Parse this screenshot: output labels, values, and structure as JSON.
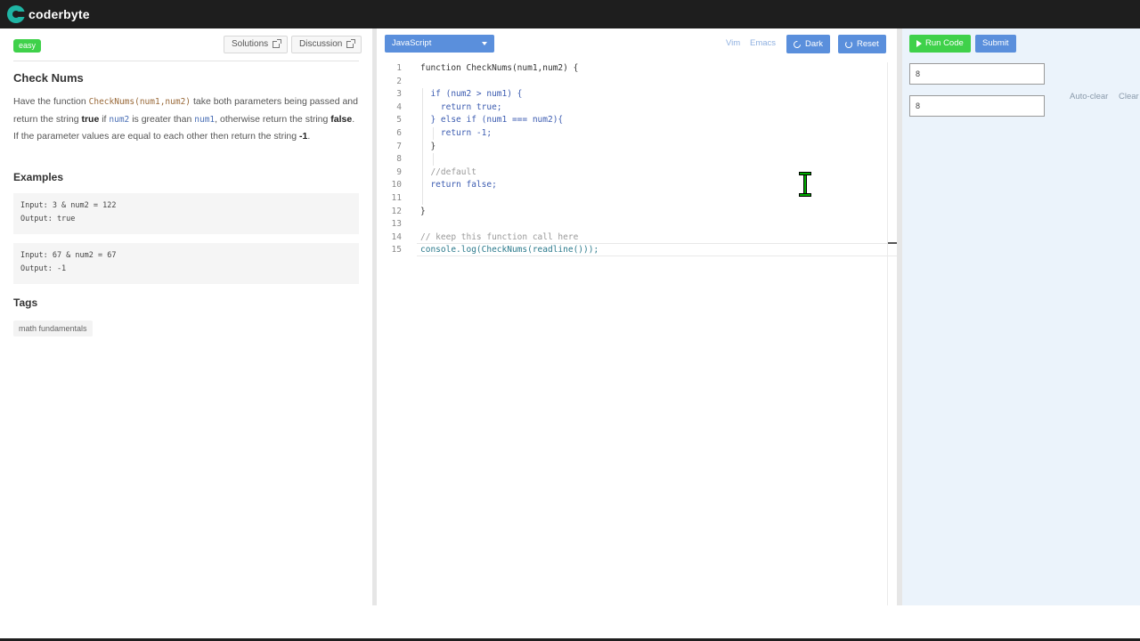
{
  "app": {
    "name": "coderbyte"
  },
  "problem": {
    "difficulty": "easy",
    "solutions_label": "Solutions",
    "discussion_label": "Discussion",
    "title": "Check Nums",
    "desc": {
      "p1": "Have the function ",
      "fn_sig": "CheckNums(num1,num2)",
      "p2": " take both parameters being passed and return the string ",
      "true_word": "true",
      "p3": " if ",
      "num2": "num2",
      "p4": " is greater than ",
      "num1": "num1",
      "p5": ", otherwise return the string ",
      "false_word": "false",
      "p6": ". If the parameter values are equal to each other then return the string ",
      "neg_one": "-1",
      "p7": "."
    },
    "examples_heading": "Examples",
    "examples": [
      {
        "input": "Input: 3 & num2 = 122",
        "output": "Output: true"
      },
      {
        "input": "Input: 67 & num2 = 67",
        "output": "Output: -1"
      }
    ],
    "tags_heading": "Tags",
    "tags": [
      "math fundamentals"
    ]
  },
  "editor": {
    "language": "JavaScript",
    "vim_label": "Vim",
    "emacs_label": "Emacs",
    "dark_label": "Dark",
    "reset_label": "Reset",
    "line_numbers": [
      "1",
      "2",
      "3",
      "4",
      "5",
      "6",
      "7",
      "8",
      "9",
      "10",
      "11",
      "12",
      "13",
      "14",
      "15"
    ],
    "lines": [
      "function CheckNums(num1,num2) {",
      "",
      "  if (num2 > num1) {",
      "    return true;",
      "  } else if (num1 === num2){",
      "    return -1;",
      "  }",
      "",
      "  //default",
      "  return false;",
      "",
      "}",
      "",
      "// keep this function call here",
      "console.log(CheckNums(readline()));"
    ]
  },
  "output": {
    "run_label": "Run Code",
    "submit_label": "Submit",
    "input_values": [
      "8",
      "8"
    ],
    "auto_clear_label": "Auto-clear",
    "clear_label": "Clear"
  },
  "colors": {
    "accent_blue": "#5a8fdc",
    "accent_green": "#3fd14a",
    "topbar": "#1e1e1e",
    "output_bg": "#ebf3fb"
  }
}
